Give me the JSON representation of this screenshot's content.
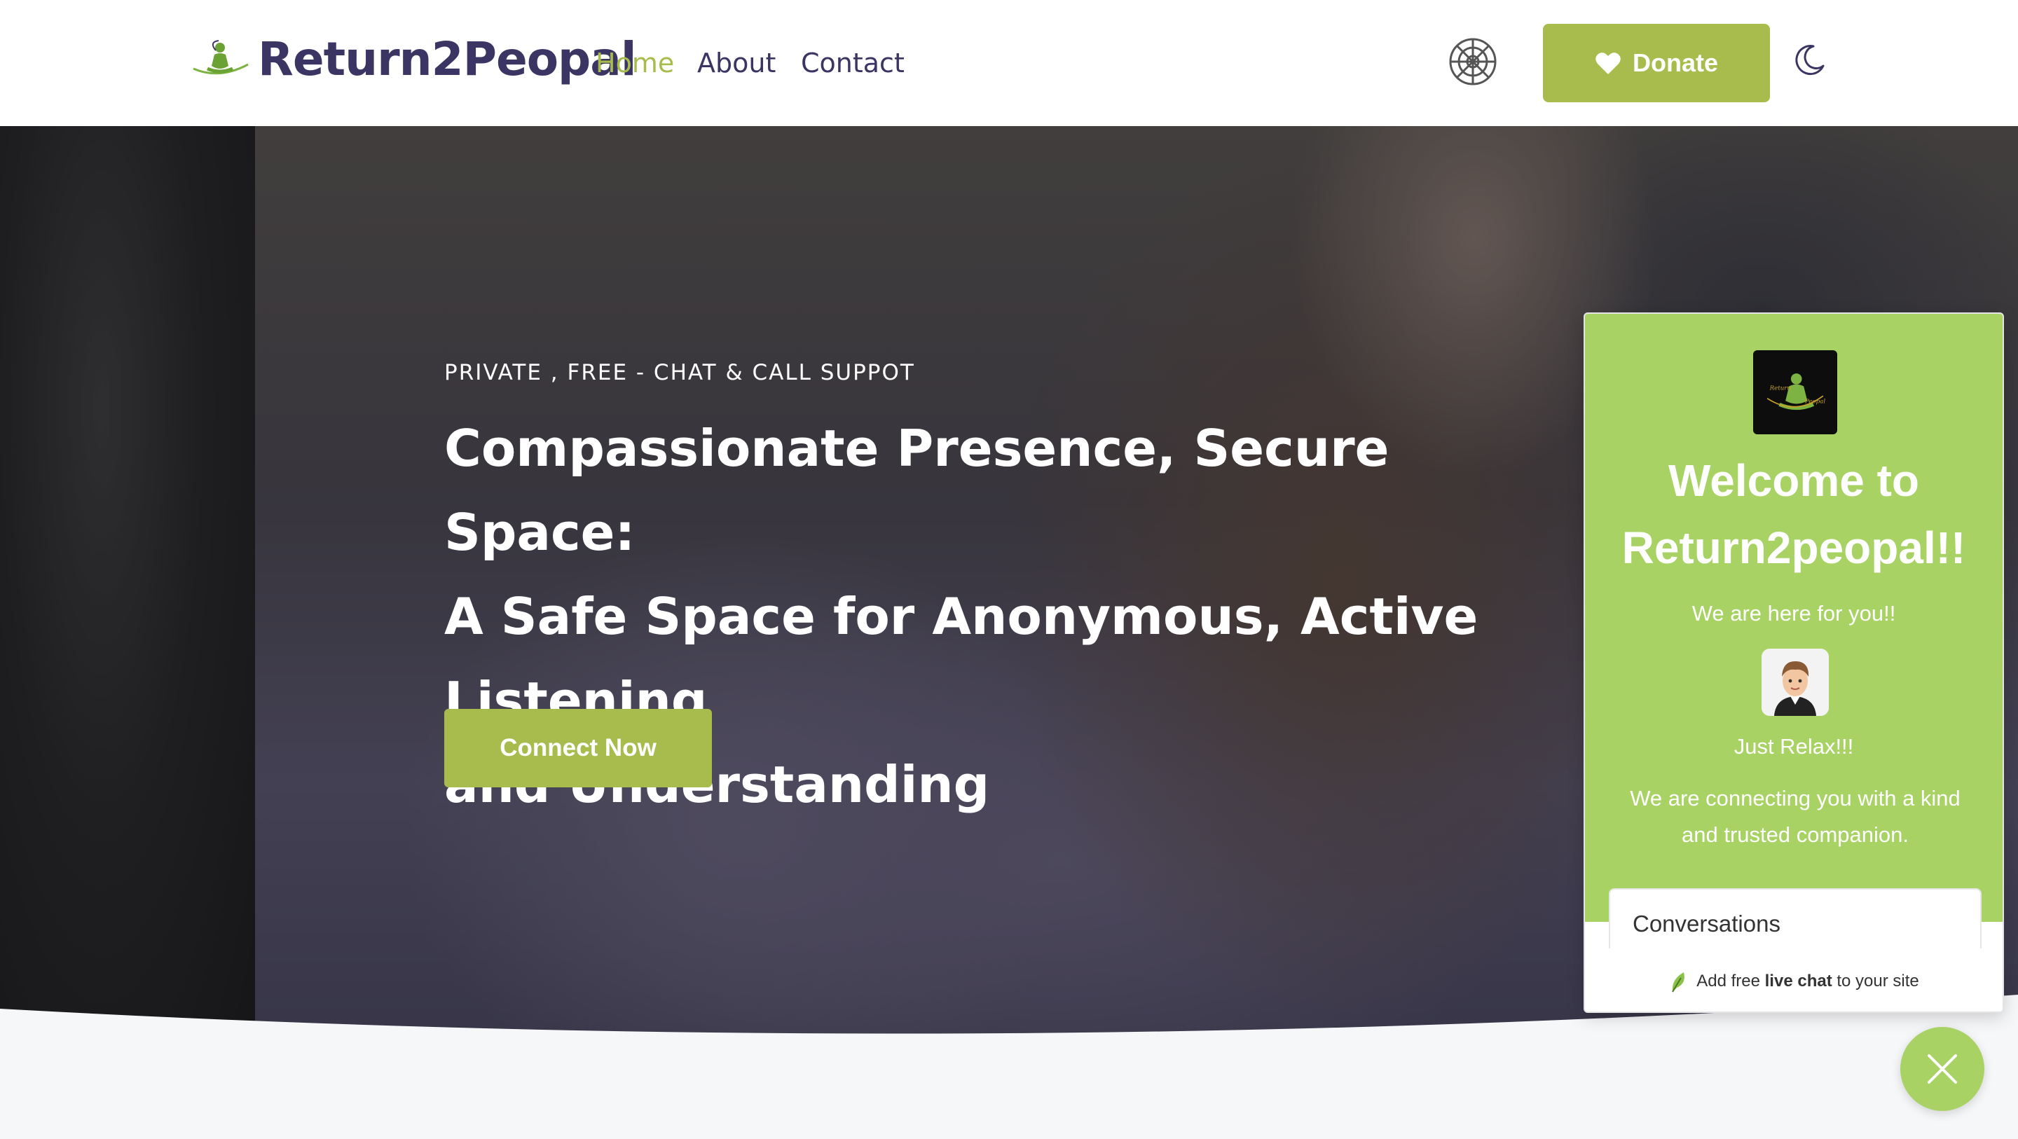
{
  "header": {
    "brand": "Return2Peopal",
    "nav": {
      "home": "Home",
      "about": "About",
      "contact": "Contact"
    },
    "donate_label": "Donate"
  },
  "hero": {
    "kicker": "PRIVATE , FREE - CHAT & CALL SUPPOT",
    "title_lines": [
      "Compassionate Presence, Secure Space:",
      "A Safe Space for Anonymous, Active Listening",
      "and Understanding"
    ],
    "cta_label": "Connect Now"
  },
  "chat": {
    "welcome_line1": "Welcome to",
    "welcome_line2": "Return2peopal!!",
    "here_for_you": "We are here for you!!",
    "relax": "Just Relax!!!",
    "connecting": "We are connecting you with a kind and trusted companion.",
    "conversations_label": "Conversations",
    "footer_prefix": "Add free ",
    "footer_bold": "live chat",
    "footer_suffix": " to your site"
  },
  "colors": {
    "accent": "#a8bc4e",
    "brand_text": "#3b3563",
    "chat_green": "#a8d364"
  },
  "icons": {
    "logo": "meditating-figure-icon",
    "language": "globe-icon",
    "donate": "heart-icon",
    "theme": "moon-icon",
    "close": "close-icon"
  }
}
